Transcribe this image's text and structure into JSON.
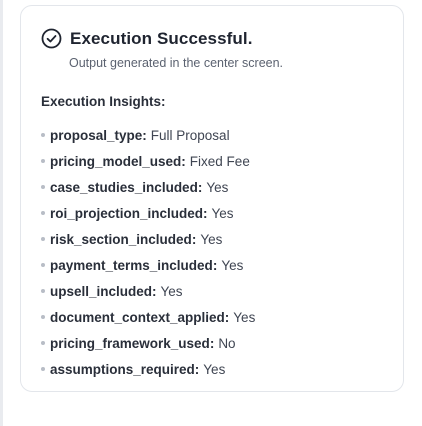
{
  "status": {
    "icon": "check-circle-icon",
    "title": "Execution Successful.",
    "subtitle": "Output generated in the center screen."
  },
  "insights": {
    "heading": "Execution Insights:",
    "items": [
      {
        "key": "proposal_type",
        "value": "Full Proposal"
      },
      {
        "key": "pricing_model_used",
        "value": "Fixed Fee"
      },
      {
        "key": "case_studies_included",
        "value": "Yes"
      },
      {
        "key": "roi_projection_included",
        "value": "Yes"
      },
      {
        "key": "risk_section_included",
        "value": "Yes"
      },
      {
        "key": "payment_terms_included",
        "value": "Yes"
      },
      {
        "key": "upsell_included",
        "value": "Yes"
      },
      {
        "key": "document_context_applied",
        "value": "Yes"
      },
      {
        "key": "pricing_framework_used",
        "value": "No"
      },
      {
        "key": "assumptions_required",
        "value": "Yes"
      }
    ]
  },
  "colors": {
    "text": "#1f2430",
    "muted": "#5b6270",
    "border": "#e3e6eb",
    "bullet": "#b8bdc6"
  }
}
